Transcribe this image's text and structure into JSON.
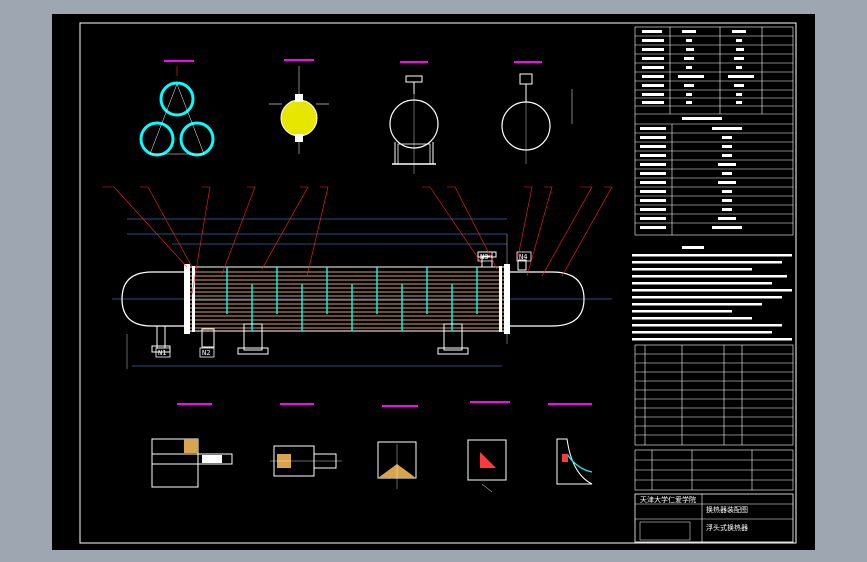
{
  "drawing": {
    "background_color": "#000000",
    "frame_color": "#ffffff",
    "accent_colors": {
      "leader": "#ff2020",
      "section_title": "#ff00ff",
      "pipe": "#00ffff",
      "tube": "#d9a44b",
      "fill_yellow": "#e6e600",
      "weld": "#ff3a3a"
    },
    "nozzle_tags": [
      "N1",
      "N2",
      "N3",
      "N4"
    ],
    "title_block": {
      "line1": "天津大学仁爱学院",
      "line2": "换热器装配图",
      "line3": "浮头式换热器"
    }
  }
}
